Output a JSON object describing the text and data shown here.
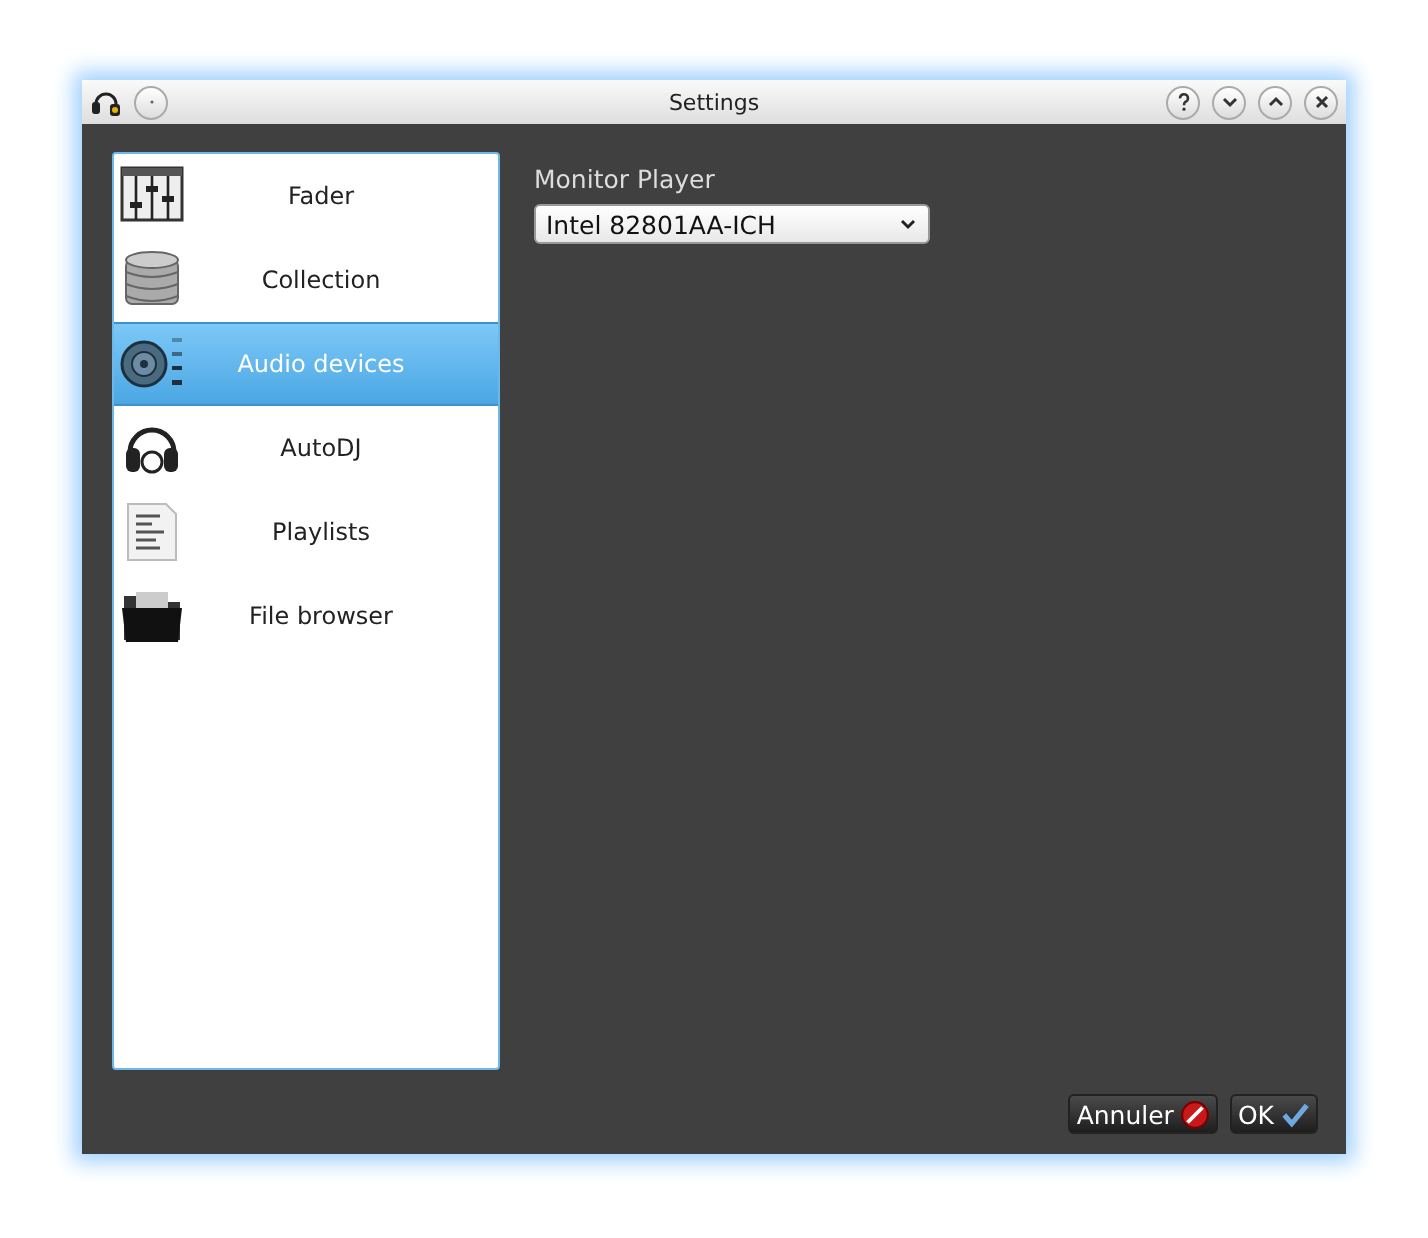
{
  "window": {
    "title": "Settings"
  },
  "sidebar": {
    "items": [
      {
        "label": "Fader",
        "selected": false
      },
      {
        "label": "Collection",
        "selected": false
      },
      {
        "label": "Audio devices",
        "selected": true
      },
      {
        "label": "AutoDJ",
        "selected": false
      },
      {
        "label": "Playlists",
        "selected": false
      },
      {
        "label": "File browser",
        "selected": false
      }
    ]
  },
  "monitor_player": {
    "label": "Monitor Player",
    "value": "Intel 82801AA-ICH"
  },
  "buttons": [
    {
      "label": "Annuler",
      "kind": "cancel"
    },
    {
      "label": "OK",
      "kind": "ok"
    }
  ]
}
